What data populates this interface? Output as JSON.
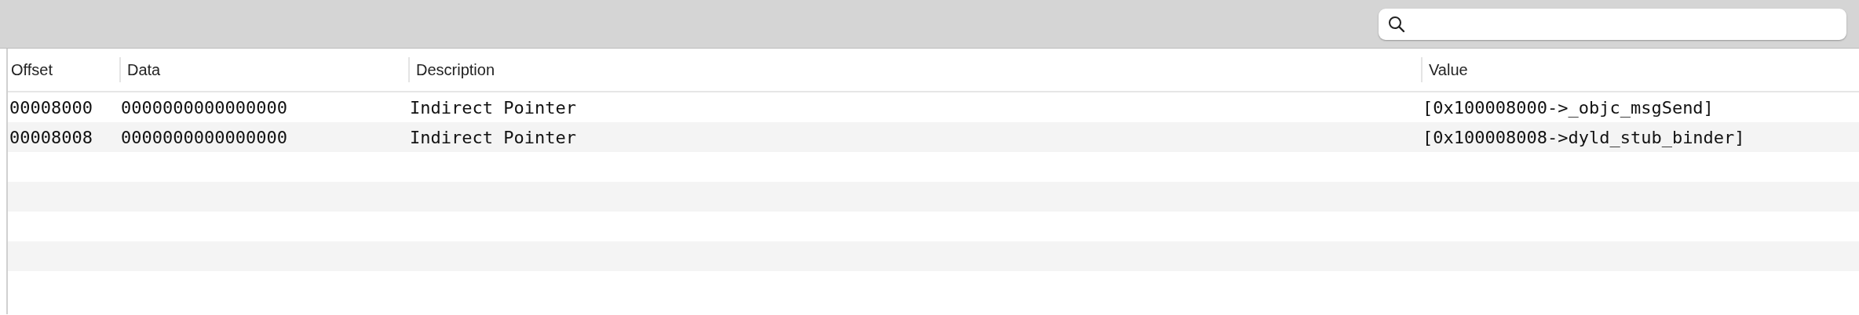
{
  "table": {
    "columns": [
      "Offset",
      "Data",
      "Description",
      "Value"
    ],
    "rows": [
      {
        "cells": [
          "00008000",
          "0000000000000000",
          "Indirect Pointer",
          "[0x100008000->_objc_msgSend]"
        ]
      },
      {
        "cells": [
          "00008008",
          "0000000000000000",
          "Indirect Pointer",
          "[0x100008008->dyld_stub_binder]"
        ]
      }
    ]
  }
}
